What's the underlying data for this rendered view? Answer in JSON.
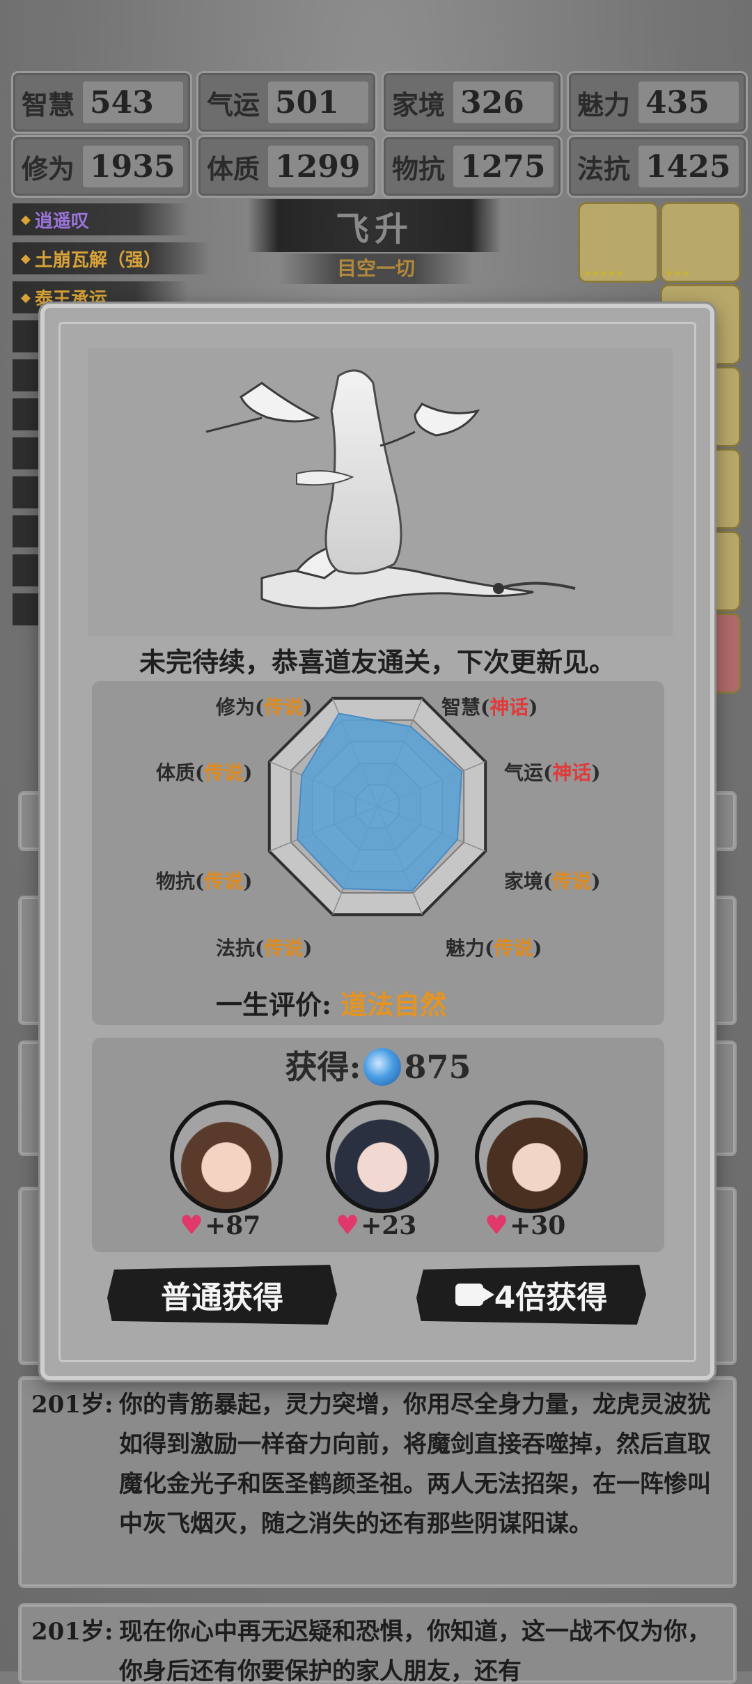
{
  "stats": [
    {
      "label": "智慧",
      "value": "543"
    },
    {
      "label": "气运",
      "value": "501"
    },
    {
      "label": "家境",
      "value": "326"
    },
    {
      "label": "魅力",
      "value": "435"
    },
    {
      "label": "修为",
      "value": "1935"
    },
    {
      "label": "体质",
      "value": "1299"
    },
    {
      "label": "物抗",
      "value": "1275"
    },
    {
      "label": "法抗",
      "value": "1425"
    }
  ],
  "talents": [
    "逍遥叹",
    "土崩瓦解（强）",
    "泰王承运"
  ],
  "stage": {
    "title": "飞升",
    "subtitle": "目空一切"
  },
  "modal": {
    "headline": "未完待续，恭喜道友通关，下次更新见。",
    "radar": {
      "labels": [
        {
          "name": "修为",
          "quality": "传说",
          "tier": "legend"
        },
        {
          "name": "智慧",
          "quality": "神话",
          "tier": "myth"
        },
        {
          "name": "气运",
          "quality": "神话",
          "tier": "myth"
        },
        {
          "name": "家境",
          "quality": "传说",
          "tier": "legend"
        },
        {
          "name": "魅力",
          "quality": "传说",
          "tier": "legend"
        },
        {
          "name": "法抗",
          "quality": "传说",
          "tier": "legend"
        },
        {
          "name": "物抗",
          "quality": "传说",
          "tier": "legend"
        },
        {
          "name": "体质",
          "quality": "传说",
          "tier": "legend"
        }
      ],
      "open": "(",
      "close": ")",
      "levels": [
        0.86,
        0.74,
        0.78,
        0.74,
        0.78,
        0.76,
        0.74,
        0.7
      ],
      "fill_color": "#5aa0d4"
    },
    "evaluation": {
      "label": "一生评价:",
      "value": "道法自然"
    },
    "reward": {
      "label": "获得:",
      "amount": "875",
      "companions": [
        {
          "name": "companion-1",
          "favor": "+87"
        },
        {
          "name": "companion-2",
          "favor": "+23"
        },
        {
          "name": "companion-3",
          "favor": "+30"
        }
      ]
    },
    "buttons": {
      "normal": "普通获得",
      "ad": "4倍获得"
    }
  },
  "logs": [
    {
      "age": "201岁:",
      "text": "你的青筋暴起，灵力突增，你用尽全身力量，龙虎灵波犹如得到激励一样奋力向前，将魔剑直接吞噬掉，然后直取魔化金光子和医圣鹤颜圣祖。两人无法招架，在一阵惨叫中灰飞烟灭，随之消失的还有那些阴谋阳谋。"
    },
    {
      "age": "201岁:",
      "text": "现在你心中再无迟疑和恐惧，你知道，这一战不仅为你，你身后还有你要保护的家人朋友，还有"
    }
  ],
  "colors": {
    "legend": "#e08a1c",
    "myth": "#e03a3a",
    "talent": "#d8a338"
  }
}
